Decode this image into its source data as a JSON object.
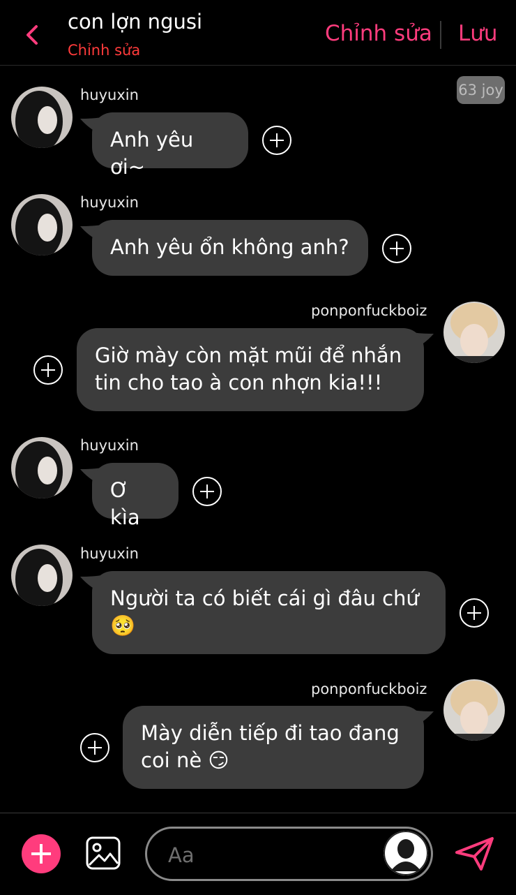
{
  "header": {
    "title": "con lợn ngusi",
    "subtitle": "Chỉnh sửa",
    "edit_label": "Chỉnh sửa",
    "save_label": "Lưu"
  },
  "counter": "63 joy",
  "messages": [
    {
      "sender": "huyuxin",
      "text": "Anh yêu ơi~"
    },
    {
      "sender": "huyuxin",
      "text": "Anh yêu ổn không anh?"
    },
    {
      "sender": "ponponfuckboiz",
      "lines": [
        "Giờ mày còn mặt mũi để nhắn",
        "tin cho tao à con nhợn kia!!!"
      ]
    },
    {
      "sender": "huyuxin",
      "text": "Ơ kìa"
    },
    {
      "sender": "huyuxin",
      "lines": [
        "Người ta có biết cái gì đâu chứ",
        "🥺"
      ]
    },
    {
      "sender": "ponponfuckboiz",
      "lines": [
        "Mày diễn tiếp đi tao đang",
        "coi nè 😏"
      ]
    }
  ],
  "composer": {
    "placeholder": "Aa"
  },
  "colors": {
    "accent": "#ff3c7d",
    "subtitle": "#ff3b3b",
    "bubble": "#3c3c3c",
    "background": "#000000"
  },
  "icons": [
    "back-chevron-icon",
    "plus-icon",
    "image-icon",
    "person-icon",
    "send-icon"
  ]
}
